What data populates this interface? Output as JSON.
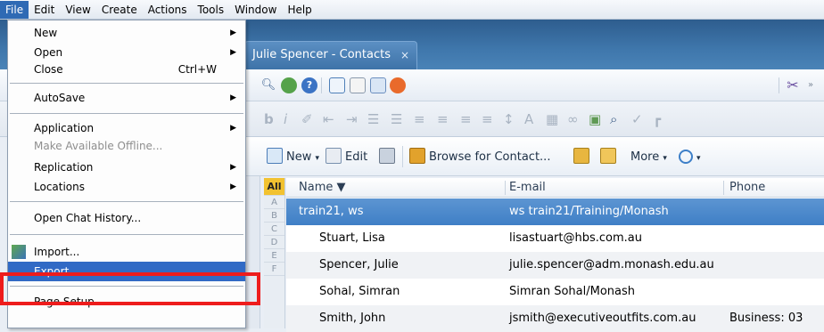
{
  "menubar": {
    "items": [
      "File",
      "Edit",
      "View",
      "Create",
      "Actions",
      "Tools",
      "Window",
      "Help"
    ]
  },
  "tab": {
    "title": "Julie Spencer - Contacts",
    "close": "×"
  },
  "file_menu": {
    "new": "New",
    "open": "Open",
    "close": "Close",
    "close_shortcut": "Ctrl+W",
    "autosave": "AutoSave",
    "application": "Application",
    "make_offline": "Make Available Offline...",
    "replication": "Replication",
    "locations": "Locations",
    "chat_history": "Open Chat History...",
    "import": "Import...",
    "export": "Export...",
    "page_setup": "Page Setup..."
  },
  "actionbar": {
    "new": "New",
    "edit": "Edit",
    "browse": "Browse for Contact...",
    "more": "More"
  },
  "alpha": [
    "All",
    "A",
    "B",
    "C",
    "D",
    "E",
    "F"
  ],
  "grid": {
    "columns": [
      "Name ▼",
      "E-mail",
      "Phone"
    ],
    "rows": [
      {
        "name": "train21, ws",
        "email": "ws train21/Training/Monash",
        "phone": ""
      },
      {
        "name": "Stuart, Lisa",
        "email": "lisastuart@hbs.com.au",
        "phone": ""
      },
      {
        "name": "Spencer, Julie",
        "email": "julie.spencer@adm.monash.edu.au",
        "phone": ""
      },
      {
        "name": "Sohal, Simran",
        "email": "Simran Sohal/Monash",
        "phone": ""
      },
      {
        "name": "Smith, John",
        "email": "jsmith@executiveoutfits.com.au",
        "phone": "Business: 03"
      }
    ]
  },
  "colors": {
    "highlight": "#316ac5",
    "selected_row": "#4a88cc",
    "annotation": "#ee1c1c",
    "alpha_all": "#f2c230"
  }
}
